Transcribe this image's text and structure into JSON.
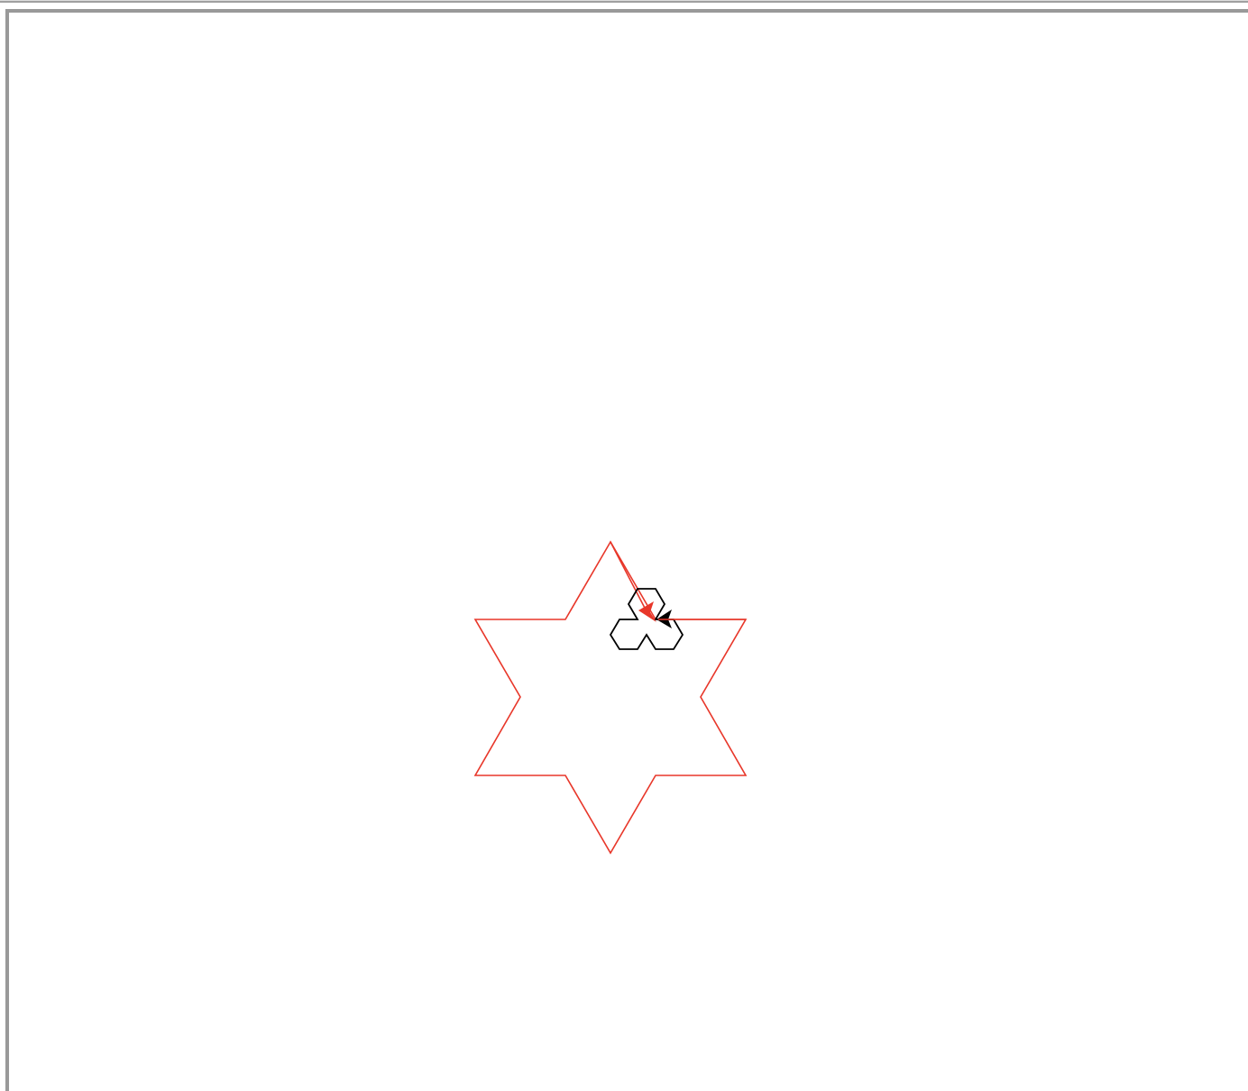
{
  "canvas": {
    "star_color": "#e8372a",
    "trefoil_color": "#000000",
    "background": "#ffffff"
  }
}
